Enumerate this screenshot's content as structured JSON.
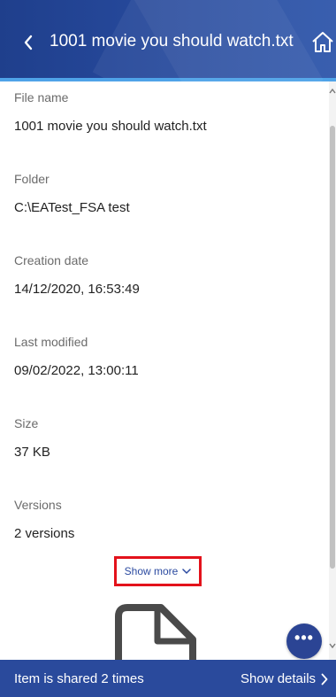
{
  "header": {
    "title": "1001 movie you should watch.txt",
    "back_icon": "chevron-left-icon",
    "home_icon": "home-icon"
  },
  "details": [
    {
      "label": "File name",
      "value": "1001 movie you should watch.txt"
    },
    {
      "label": "Folder",
      "value": "C:\\EATest_FSA test"
    },
    {
      "label": "Creation date",
      "value": "14/12/2020, 16:53:49"
    },
    {
      "label": "Last modified",
      "value": "09/02/2022, 13:00:11"
    },
    {
      "label": "Size",
      "value": "37 KB"
    },
    {
      "label": "Versions",
      "value": "2 versions"
    }
  ],
  "show_more": {
    "label": "Show more",
    "icon": "chevron-down-icon"
  },
  "preview": {
    "icon": "document-icon"
  },
  "fab": {
    "label": "•••",
    "icon": "more-icon"
  },
  "footer": {
    "text": "Item is shared 2 times",
    "details_label": "Show details",
    "details_icon": "chevron-right-icon"
  },
  "colors": {
    "header": "#274a9d",
    "accent": "#4fa3e8",
    "highlight": "#e3121b",
    "footer": "#2a4a9c"
  }
}
